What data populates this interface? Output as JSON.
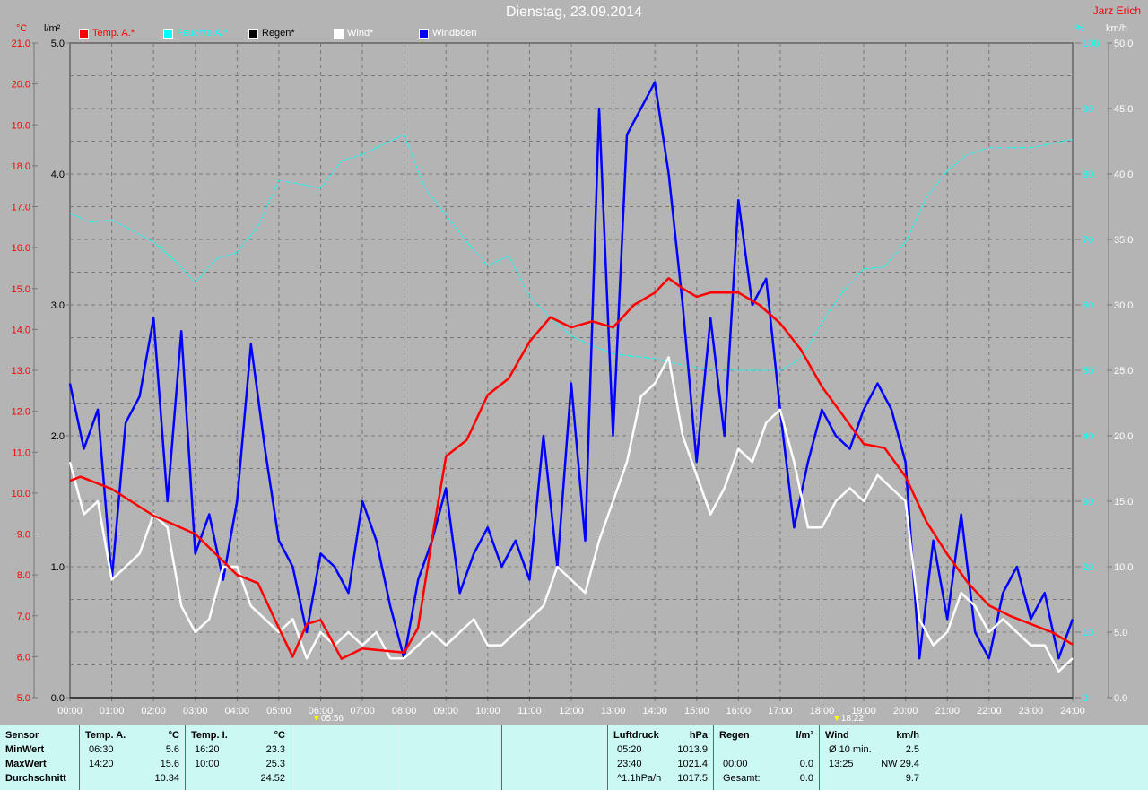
{
  "header": {
    "title": "Dienstag, 23.09.2014",
    "author": "Jarz Erich"
  },
  "legend": [
    {
      "label": "Temp. A.*",
      "color": "#ff0000"
    },
    {
      "label": "Feuchte A.*",
      "color": "#00ffff"
    },
    {
      "label": "Regen*",
      "color": "#000000"
    },
    {
      "label": "Wind*",
      "color": "#ffffff"
    },
    {
      "label": "Windböen",
      "color": "#0000ff"
    }
  ],
  "units": {
    "temp": "°C",
    "rain": "l/m²",
    "hum": "%",
    "wind": "km/h"
  },
  "markers": {
    "sunrise": "05:56",
    "sunset": "18:22"
  },
  "chart_data": {
    "type": "line",
    "title": "Dienstag, 23.09.2014",
    "x_ticks": [
      "00:00",
      "01:00",
      "02:00",
      "03:00",
      "04:00",
      "05:00",
      "06:00",
      "07:00",
      "08:00",
      "09:00",
      "10:00",
      "11:00",
      "12:00",
      "13:00",
      "14:00",
      "15:00",
      "16:00",
      "17:00",
      "18:00",
      "19:00",
      "20:00",
      "21:00",
      "22:00",
      "23:00",
      "24:00"
    ],
    "xlim_hours": [
      0,
      24
    ],
    "axes": {
      "temp": {
        "range": [
          5,
          21
        ],
        "ticks": [
          "21.0",
          "20.0",
          "19.0",
          "18.0",
          "17.0",
          "16.0",
          "15.0",
          "14.0",
          "13.0",
          "12.0",
          "11.0",
          "10.0",
          "9.0",
          "8.0",
          "7.0",
          "6.0",
          "5.0"
        ]
      },
      "rain": {
        "range": [
          0,
          5
        ],
        "ticks": [
          "5.0",
          "4.0",
          "3.0",
          "2.0",
          "1.0",
          "0.0"
        ]
      },
      "hum": {
        "range": [
          0,
          100
        ],
        "ticks": [
          "100",
          "90",
          "80",
          "70",
          "60",
          "50",
          "40",
          "30",
          "20",
          "10",
          "0"
        ]
      },
      "wind": {
        "range": [
          0,
          50
        ],
        "ticks": [
          "50.0",
          "45.0",
          "40.0",
          "35.0",
          "30.0",
          "25.0",
          "20.0",
          "15.0",
          "10.0",
          "5.0",
          "0.0"
        ]
      }
    },
    "series": [
      {
        "name": "Temp. A.*",
        "axis": "temp",
        "color": "#ff0000",
        "x": [
          0,
          0.25,
          1,
          2,
          3,
          4,
          4.5,
          5,
          5.33,
          5.67,
          6,
          6.5,
          7,
          8,
          8.33,
          8.67,
          9,
          9.5,
          10,
          10.5,
          11,
          11.5,
          12,
          12.5,
          13,
          13.5,
          14,
          14.33,
          14.67,
          15,
          15.33,
          16,
          16.5,
          17,
          17.5,
          18,
          18.5,
          19,
          19.5,
          20,
          20.5,
          21,
          21.5,
          22,
          22.5,
          23,
          23.5,
          24
        ],
        "values": [
          10.3,
          10.4,
          10.1,
          9.45,
          9.0,
          8.0,
          7.8,
          6.7,
          6.0,
          6.8,
          6.9,
          5.95,
          6.2,
          6.1,
          6.7,
          8.9,
          10.9,
          11.3,
          12.4,
          12.8,
          13.7,
          14.3,
          14.05,
          14.2,
          14.05,
          14.6,
          14.9,
          15.25,
          15.0,
          14.8,
          14.9,
          14.9,
          14.6,
          14.15,
          13.5,
          12.6,
          11.9,
          11.2,
          11.1,
          10.4,
          9.3,
          8.5,
          7.8,
          7.25,
          7.0,
          6.8,
          6.6,
          6.3
        ]
      },
      {
        "name": "Feuchte A.*",
        "axis": "hum",
        "color": "#00ffff",
        "x": [
          0,
          0.5,
          1,
          2,
          2.5,
          3,
          3.5,
          4,
          4.5,
          5,
          5.5,
          6,
          6.5,
          7,
          8,
          8.5,
          9,
          9.5,
          10,
          10.5,
          11,
          11.5,
          12,
          12.5,
          13,
          14,
          14.5,
          15,
          16,
          17,
          17.5,
          18,
          18.5,
          19,
          19.5,
          20,
          20.5,
          21,
          21.5,
          22,
          23,
          24
        ],
        "values": [
          74,
          72.6,
          73,
          69.6,
          66.8,
          63.4,
          67,
          68,
          72,
          79,
          78.5,
          77.8,
          82,
          83,
          86,
          77.8,
          73.7,
          69.6,
          66,
          67.5,
          61.4,
          58,
          55.2,
          53.8,
          52.5,
          51.8,
          51,
          50.4,
          50,
          50,
          51.8,
          57.3,
          62,
          65.5,
          65.8,
          69.6,
          76.4,
          80.5,
          83,
          84,
          84,
          85.3
        ]
      },
      {
        "name": "Regen*",
        "axis": "rain",
        "color": "#000000",
        "x": [
          0,
          24
        ],
        "values": [
          0,
          0
        ]
      },
      {
        "name": "Wind*",
        "axis": "wind",
        "color": "#ffffff",
        "x_step_hours": 0.3333,
        "values": [
          18,
          14,
          15,
          9,
          10,
          11,
          14,
          13,
          7,
          5,
          6,
          10,
          10,
          7,
          6,
          5,
          6,
          3,
          5,
          4,
          5,
          4,
          5,
          3,
          3,
          4,
          5,
          4,
          5,
          6,
          4,
          4,
          5,
          6,
          7,
          10,
          9,
          8,
          12,
          15,
          18,
          23,
          24,
          26,
          20,
          17,
          14,
          16,
          19,
          18,
          21,
          22,
          18,
          13,
          13,
          15,
          16,
          15,
          17,
          16,
          15,
          6,
          4,
          5,
          8,
          7,
          5,
          6,
          5,
          4,
          4,
          2,
          3
        ]
      },
      {
        "name": "Windböen",
        "axis": "wind",
        "color": "#0000ff",
        "x_step_hours": 0.3333,
        "values": [
          24,
          19,
          22,
          9,
          21,
          23,
          29,
          15,
          28,
          11,
          14,
          9,
          15,
          27,
          19,
          12,
          10,
          5,
          11,
          10,
          8,
          15,
          12,
          7,
          3,
          9,
          12,
          16,
          8,
          11,
          13,
          10,
          12,
          9,
          20,
          10,
          24,
          12,
          45,
          20,
          43,
          45,
          47,
          40,
          30,
          18,
          29,
          20,
          38,
          30,
          32,
          22,
          13,
          18,
          22,
          20,
          19,
          22,
          24,
          22,
          18,
          3,
          12,
          6,
          14,
          5,
          3,
          8,
          10,
          6,
          8,
          3,
          6
        ]
      }
    ]
  },
  "table": {
    "sensor": {
      "title": "Sensor",
      "rows": [
        "MinWert",
        "MaxWert",
        "Durchschnitt"
      ]
    },
    "tempA": {
      "title": "Temp. A.",
      "unit": "°C",
      "rows": [
        [
          "06:30",
          "5.6"
        ],
        [
          "14:20",
          "15.6"
        ],
        [
          "",
          "10.34"
        ]
      ]
    },
    "tempI": {
      "title": "Temp. I.",
      "unit": "°C",
      "rows": [
        [
          "16:20",
          "23.3"
        ],
        [
          "10:00",
          "25.3"
        ],
        [
          "",
          "24.52"
        ]
      ]
    },
    "pressure": {
      "title": "Luftdruck",
      "unit": "hPa",
      "rows": [
        [
          "05:20",
          "1013.9"
        ],
        [
          "23:40",
          "1021.4"
        ],
        [
          "^1.1hPa/h",
          "1017.5"
        ]
      ]
    },
    "rain": {
      "title": "Regen",
      "unit": "l/m²",
      "rows": [
        [
          "",
          ""
        ],
        [
          "00:00",
          "0.0"
        ],
        [
          "Gesamt:",
          "0.0"
        ]
      ]
    },
    "wind": {
      "title": "Wind",
      "unit": "km/h",
      "rows": [
        [
          "Ø 10 min.",
          "2.5"
        ],
        [
          "13:25",
          "NW 29.4"
        ],
        [
          "",
          "9.7"
        ]
      ]
    }
  }
}
